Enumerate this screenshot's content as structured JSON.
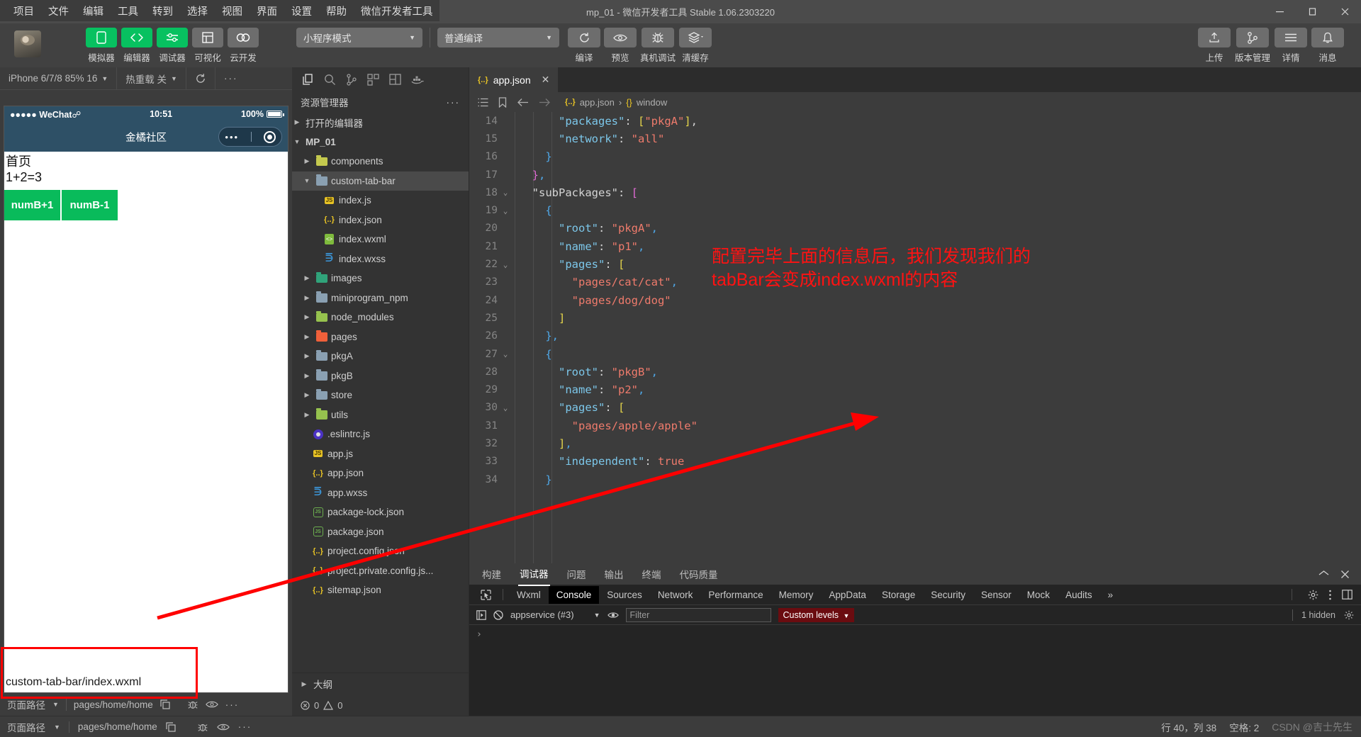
{
  "window": {
    "title": "mp_01 - 微信开发者工具 Stable 1.06.2303220",
    "minimize": "–",
    "maximize": "❐",
    "close": "✕"
  },
  "menubar": {
    "items": [
      "项目",
      "文件",
      "编辑",
      "工具",
      "转到",
      "选择",
      "视图",
      "界面",
      "设置",
      "帮助",
      "微信开发者工具"
    ]
  },
  "toolbar": {
    "mode_select": "小程序模式",
    "compile_select": "普通编译",
    "left_buttons": [
      {
        "label": "模拟器",
        "icon": "phone-icon",
        "style": "green"
      },
      {
        "label": "编辑器",
        "icon": "code-icon",
        "style": "green"
      },
      {
        "label": "调试器",
        "icon": "sliders-icon",
        "style": "green"
      },
      {
        "label": "可视化",
        "icon": "layout-icon",
        "style": "grey"
      },
      {
        "label": "云开发",
        "icon": "cloud-icon",
        "style": "grey"
      }
    ],
    "mid_buttons": [
      {
        "label": "编译",
        "icon": "refresh-icon"
      },
      {
        "label": "预览",
        "icon": "eye-icon"
      },
      {
        "label": "真机调试",
        "icon": "bug-icon"
      },
      {
        "label": "清缓存",
        "icon": "layers-icon"
      }
    ],
    "right_buttons": [
      {
        "label": "上传",
        "icon": "upload-icon"
      },
      {
        "label": "版本管理",
        "icon": "branch-icon"
      },
      {
        "label": "详情",
        "icon": "menu-icon"
      },
      {
        "label": "消息",
        "icon": "bell-icon"
      }
    ]
  },
  "simulator": {
    "device": "iPhone 6/7/8 85% 16",
    "hot_reload": "热重载 关",
    "refresh_icon": "refresh-icon",
    "more_icon": "more-icon",
    "phone": {
      "carrier": "WeChat",
      "signal_dots": "●●●●●",
      "time": "10:51",
      "battery_pct": "100%",
      "nav_title": "金橘社区",
      "page_title": "首页",
      "expression": "1+2=3",
      "buttons": [
        "numB+1",
        "numB-1"
      ],
      "tabbar_path": "custom-tab-bar/index.wxml"
    },
    "footer": {
      "page_path_label": "页面路径",
      "page_path_value": "pages/home/home",
      "copy_icon": "copy-icon",
      "bug_icon": "bug-icon",
      "eye_icon": "eye-icon",
      "more_icon": "more-icon"
    }
  },
  "explorer": {
    "iconbar": [
      "files-icon",
      "search-icon",
      "source-control-icon",
      "extensions-icon",
      "split-icon",
      "docker-icon"
    ],
    "title": "资源管理器",
    "more": "···",
    "sections": {
      "open_editors": "打开的编辑器",
      "project": "MP_01",
      "outline": "大纲"
    },
    "tree": [
      {
        "label": "components",
        "type": "folder",
        "color": "yellow",
        "depth": 1,
        "arrow": "▶"
      },
      {
        "label": "custom-tab-bar",
        "type": "folder",
        "color": "plain",
        "depth": 1,
        "arrow": "▼",
        "selected": true
      },
      {
        "label": "index.js",
        "type": "js",
        "depth": 2
      },
      {
        "label": "index.json",
        "type": "json",
        "depth": 2
      },
      {
        "label": "index.wxml",
        "type": "wxml",
        "depth": 2
      },
      {
        "label": "index.wxss",
        "type": "wxss",
        "depth": 2
      },
      {
        "label": "images",
        "type": "folder",
        "color": "teal",
        "depth": 1,
        "arrow": "▶"
      },
      {
        "label": "miniprogram_npm",
        "type": "folder",
        "color": "plain",
        "depth": 1,
        "arrow": "▶"
      },
      {
        "label": "node_modules",
        "type": "folder",
        "color": "green",
        "depth": 1,
        "arrow": "▶"
      },
      {
        "label": "pages",
        "type": "folder",
        "color": "orange",
        "depth": 1,
        "arrow": "▶"
      },
      {
        "label": "pkgA",
        "type": "folder",
        "color": "plain",
        "depth": 1,
        "arrow": "▶"
      },
      {
        "label": "pkgB",
        "type": "folder",
        "color": "plain",
        "depth": 1,
        "arrow": "▶"
      },
      {
        "label": "store",
        "type": "folder",
        "color": "plain",
        "depth": 1,
        "arrow": "▶"
      },
      {
        "label": "utils",
        "type": "folder",
        "color": "green",
        "depth": 1,
        "arrow": "▶"
      },
      {
        "label": ".eslintrc.js",
        "type": "eslint",
        "depth": 1
      },
      {
        "label": "app.js",
        "type": "js",
        "depth": 1
      },
      {
        "label": "app.json",
        "type": "json",
        "depth": 1
      },
      {
        "label": "app.wxss",
        "type": "wxss",
        "depth": 1
      },
      {
        "label": "package-lock.json",
        "type": "node",
        "depth": 1
      },
      {
        "label": "package.json",
        "type": "node",
        "depth": 1
      },
      {
        "label": "project.config.json",
        "type": "json",
        "depth": 1
      },
      {
        "label": "project.private.config.js...",
        "type": "json",
        "depth": 1
      },
      {
        "label": "sitemap.json",
        "type": "json",
        "depth": 1
      }
    ],
    "status": {
      "errors": "0",
      "warnings": "0"
    }
  },
  "editor": {
    "tab": {
      "label": "app.json",
      "icon": "json-icon",
      "close": "✕"
    },
    "breadcrumb": {
      "file": "app.json",
      "separator": "›",
      "scope": "window",
      "scope_icon": "{}"
    },
    "toolbar_icons": [
      "outline-icon",
      "bookmark-icon",
      "back-icon",
      "forward-icon"
    ],
    "lines": [
      {
        "n": "14",
        "fold": "",
        "text": "      \"packages\": [\"pkgA\"],"
      },
      {
        "n": "15",
        "fold": "",
        "text": "      \"network\": \"all\""
      },
      {
        "n": "16",
        "fold": "",
        "text": "    }"
      },
      {
        "n": "17",
        "fold": "",
        "text": "  },"
      },
      {
        "n": "18",
        "fold": "⌄",
        "text": "  \"subPackages\": ["
      },
      {
        "n": "19",
        "fold": "⌄",
        "text": "    {"
      },
      {
        "n": "20",
        "fold": "",
        "text": "      \"root\": \"pkgA\","
      },
      {
        "n": "21",
        "fold": "",
        "text": "      \"name\": \"p1\","
      },
      {
        "n": "22",
        "fold": "⌄",
        "text": "      \"pages\": ["
      },
      {
        "n": "23",
        "fold": "",
        "text": "        \"pages/cat/cat\","
      },
      {
        "n": "24",
        "fold": "",
        "text": "        \"pages/dog/dog\""
      },
      {
        "n": "25",
        "fold": "",
        "text": "      ]"
      },
      {
        "n": "26",
        "fold": "",
        "text": "    },"
      },
      {
        "n": "27",
        "fold": "⌄",
        "text": "    {"
      },
      {
        "n": "28",
        "fold": "",
        "text": "      \"root\": \"pkgB\","
      },
      {
        "n": "29",
        "fold": "",
        "text": "      \"name\": \"p2\","
      },
      {
        "n": "30",
        "fold": "⌄",
        "text": "      \"pages\": ["
      },
      {
        "n": "31",
        "fold": "",
        "text": "        \"pages/apple/apple\""
      },
      {
        "n": "32",
        "fold": "",
        "text": "      ],"
      },
      {
        "n": "33",
        "fold": "",
        "text": "      \"independent\": true"
      },
      {
        "n": "34",
        "fold": "",
        "text": "    }"
      }
    ],
    "annotation": "配置完毕上面的信息后，我们发现我们的\ntabBar会变成index.wxml的内容"
  },
  "devtools": {
    "top_tabs": [
      "构建",
      "调试器",
      "问题",
      "输出",
      "终端",
      "代码质量"
    ],
    "top_active": "调试器",
    "collapse_icon": "chevron-up-icon",
    "close_icon": "close-icon",
    "panel_tabs": [
      "Wxml",
      "Console",
      "Sources",
      "Network",
      "Performance",
      "Memory",
      "AppData",
      "Storage",
      "Security",
      "Sensor",
      "Mock",
      "Audits"
    ],
    "panel_active": "Console",
    "overflow": "»",
    "panel_right_icons": [
      "gear-icon",
      "kebab-icon",
      "dock-icon"
    ],
    "console": {
      "execute_icon": "execute-icon",
      "clear_icon": "clear-icon",
      "context": "appservice (#3)",
      "eye_icon": "eye-icon",
      "filter_placeholder": "Filter",
      "levels": "Custom levels",
      "hidden_count": "1 hidden",
      "settings_icon": "gear-icon",
      "prompt": "›"
    }
  },
  "statusbar": {
    "page_path_label": "页面路径",
    "page_path_value": "pages/home/home",
    "errors": "0",
    "warnings": "0",
    "cursor": "行 40，列 38",
    "spaces": "空格: 2",
    "watermark": "CSDN @吉士先生"
  }
}
